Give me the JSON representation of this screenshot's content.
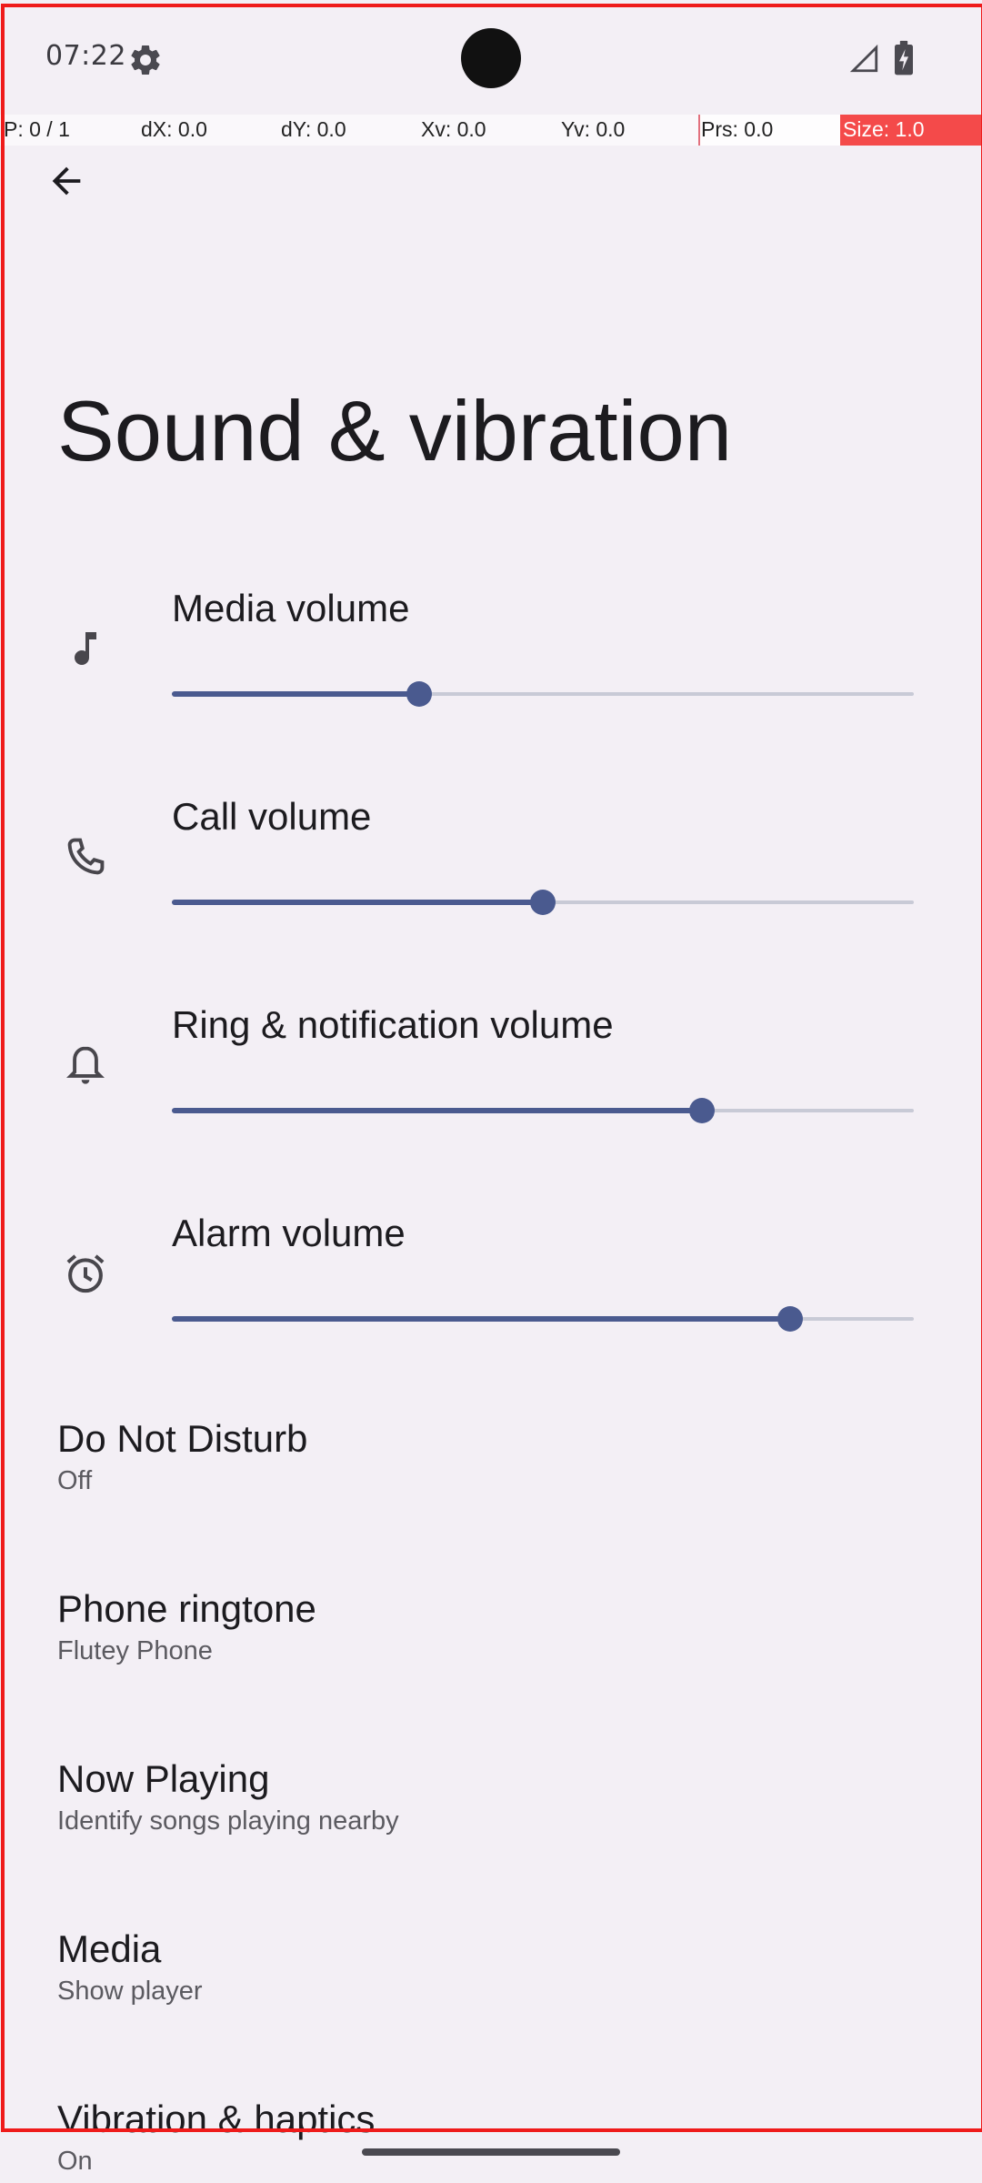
{
  "status_bar": {
    "time": "07:22",
    "settings_icon": "gear-icon",
    "signal_icon": "signal-icon",
    "battery_icon": "battery-charging-icon"
  },
  "pointer_overlay": {
    "p": "P: 0 / 1",
    "dx": "dX: 0.0",
    "dy": "dY: 0.0",
    "xv": "Xv: 0.0",
    "yv": "Yv: 0.0",
    "prs": "Prs: 0.0",
    "size": "Size: 1.0"
  },
  "header": {
    "back_icon": "back-arrow-icon",
    "title": "Sound & vibration"
  },
  "volumes": [
    {
      "label": "Media volume",
      "icon": "music-note-icon",
      "level": 0.333
    },
    {
      "label": "Call volume",
      "icon": "phone-icon",
      "level": 0.5
    },
    {
      "label": "Ring & notification volume",
      "icon": "bell-icon",
      "level": 0.714
    },
    {
      "label": "Alarm volume",
      "icon": "alarm-clock-icon",
      "level": 0.833
    }
  ],
  "settings": [
    {
      "title": "Do Not Disturb",
      "subtitle": "Off"
    },
    {
      "title": "Phone ringtone",
      "subtitle": "Flutey Phone"
    },
    {
      "title": "Now Playing",
      "subtitle": "Identify songs playing nearby"
    },
    {
      "title": "Media",
      "subtitle": "Show player"
    },
    {
      "title": "Vibration & haptics",
      "subtitle": "On"
    }
  ],
  "colors": {
    "background": "#F3EFF5",
    "accent": "#4A5A8F",
    "track": "#C8CAD6",
    "frame": "#EF1B1B"
  }
}
